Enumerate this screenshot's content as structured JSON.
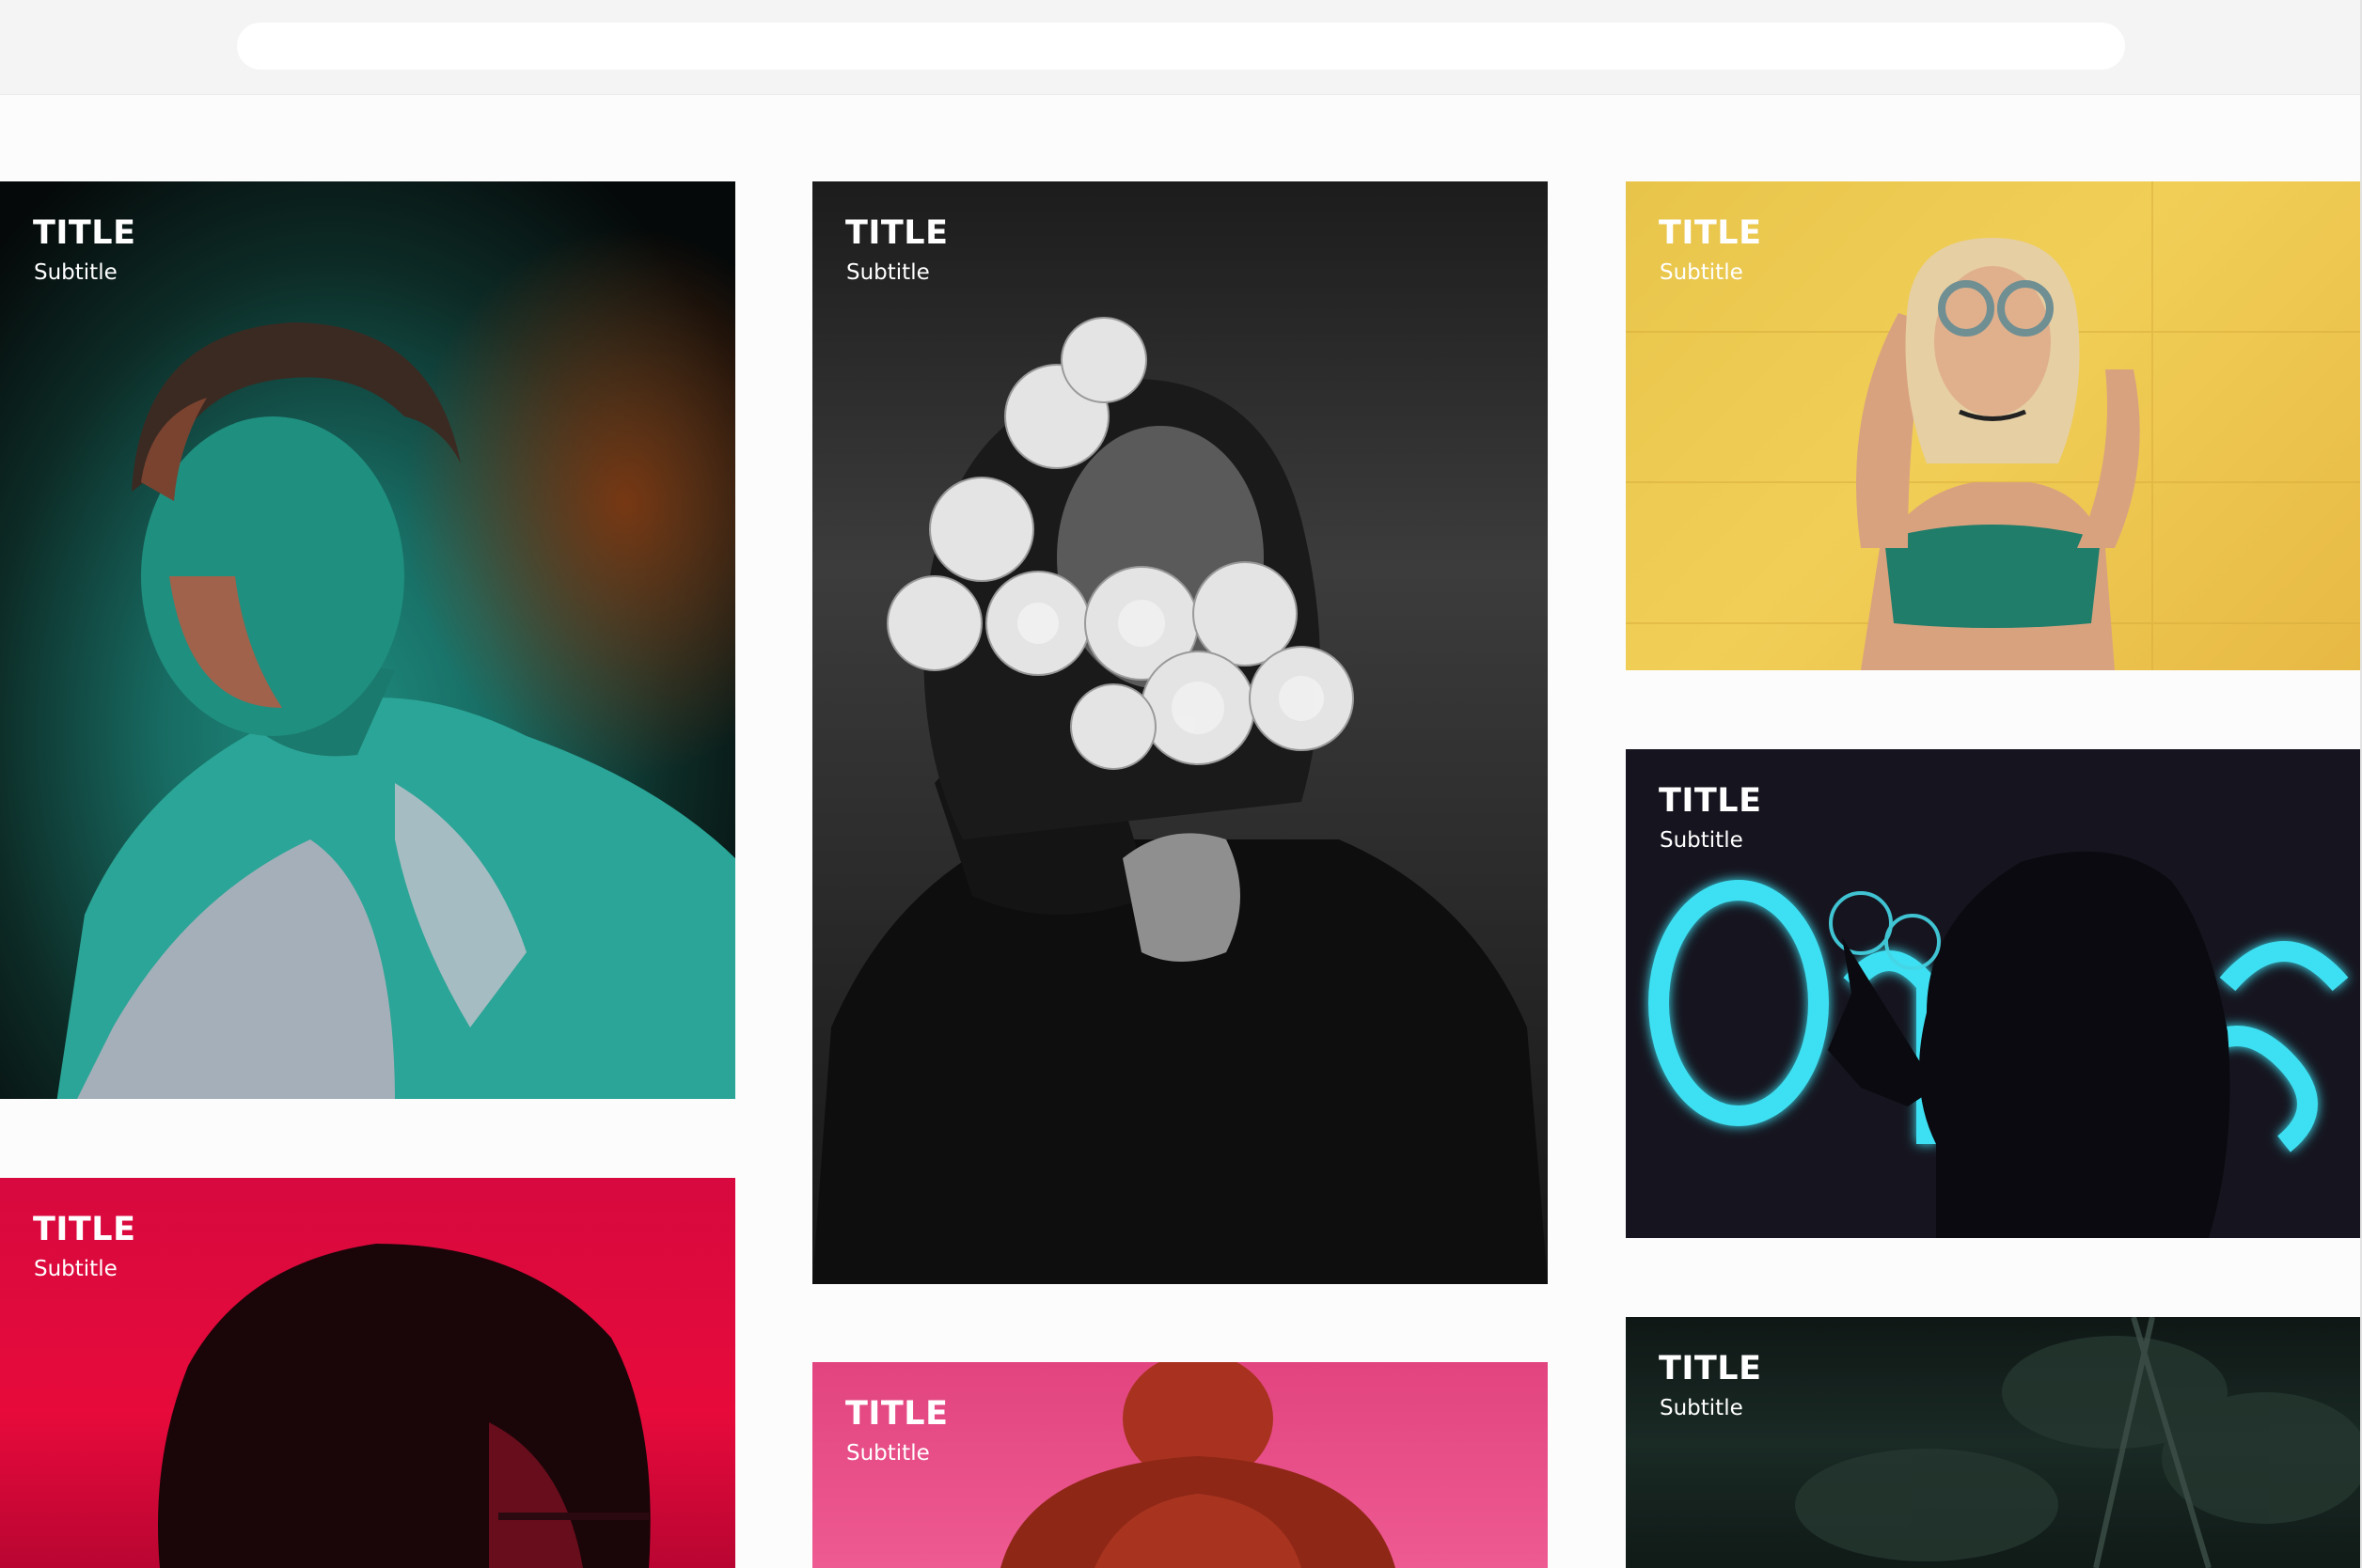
{
  "browser": {
    "address": ""
  },
  "gallery": {
    "cards": [
      {
        "title": "TITLE",
        "subtitle": "Subtitle",
        "photo": "young-man-teal-red-light-photo"
      },
      {
        "title": "TITLE",
        "subtitle": "Subtitle",
        "photo": "woman-with-white-flowers-bw-photo"
      },
      {
        "title": "TITLE",
        "subtitle": "Subtitle",
        "photo": "woman-with-glasses-yellow-wall-photo"
      },
      {
        "title": "TITLE",
        "subtitle": "Subtitle",
        "photo": "silhouette-neon-sign-photo"
      },
      {
        "title": "TITLE",
        "subtitle": "Subtitle",
        "photo": "silhouette-red-background-photo"
      },
      {
        "title": "TITLE",
        "subtitle": "Subtitle",
        "photo": "red-hair-bun-pink-wall-photo"
      },
      {
        "title": "TITLE",
        "subtitle": "Subtitle",
        "photo": "dark-foliage-photo"
      }
    ]
  },
  "colors": {
    "page_background": "#fcfcfc",
    "browser_bar": "#f4f4f4",
    "address_bar": "#ffffff",
    "card_text": "#ffffff"
  }
}
